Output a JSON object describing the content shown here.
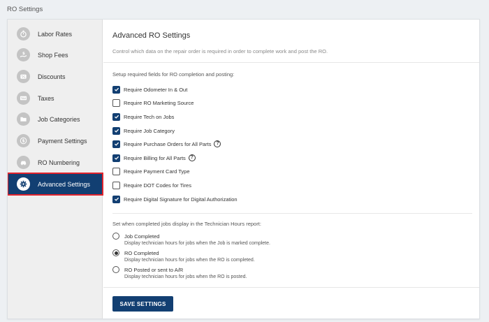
{
  "page": {
    "title": "RO Settings"
  },
  "sidebar": {
    "items": [
      {
        "label": "Labor Rates",
        "icon": "stopwatch-icon"
      },
      {
        "label": "Shop Fees",
        "icon": "hand-money-icon"
      },
      {
        "label": "Discounts",
        "icon": "discount-tag-icon"
      },
      {
        "label": "Taxes",
        "icon": "tax-icon"
      },
      {
        "label": "Job Categories",
        "icon": "folder-icon"
      },
      {
        "label": "Payment Settings",
        "icon": "dollar-icon"
      },
      {
        "label": "RO Numbering",
        "icon": "car-icon"
      },
      {
        "label": "Advanced Settings",
        "icon": "gear-icon",
        "active": true
      }
    ]
  },
  "main": {
    "title": "Advanced RO Settings",
    "description": "Control which data on the repair order is required in order to complete work and post the RO.",
    "required_section": {
      "label": "Setup required fields for RO completion and posting:",
      "items": [
        {
          "label": "Require Odometer In & Out",
          "checked": true,
          "help": false
        },
        {
          "label": "Require RO Marketing Source",
          "checked": false,
          "help": false
        },
        {
          "label": "Require Tech on Jobs",
          "checked": true,
          "help": false
        },
        {
          "label": "Require Job Category",
          "checked": true,
          "help": false
        },
        {
          "label": "Require Purchase Orders for All Parts",
          "checked": true,
          "help": true
        },
        {
          "label": "Require Billing for All Parts",
          "checked": true,
          "help": true
        },
        {
          "label": "Require Payment Card Type",
          "checked": false,
          "help": false
        },
        {
          "label": "Require DOT Codes for Tires",
          "checked": false,
          "help": false
        },
        {
          "label": "Require Digital Signature for Digital Authorization",
          "checked": true,
          "help": false
        }
      ]
    },
    "tech_hours_section": {
      "label": "Set when completed jobs display in the Technician Hours report:",
      "options": [
        {
          "label": "Job Completed",
          "description": "Display technician hours for jobs when the Job is marked complete.",
          "selected": false
        },
        {
          "label": "RO Completed",
          "description": "Display technician hours for jobs when the RO is completed.",
          "selected": true
        },
        {
          "label": "RO Posted or sent to A/R",
          "description": "Display technician hours for jobs when the RO is posted.",
          "selected": false
        }
      ]
    },
    "save_label": "SAVE SETTINGS",
    "help_glyph": "?"
  },
  "colors": {
    "primary": "#123f72",
    "highlight_border": "#e2232c",
    "sidebar_bg": "#efefef",
    "page_bg": "#edf0f3"
  }
}
